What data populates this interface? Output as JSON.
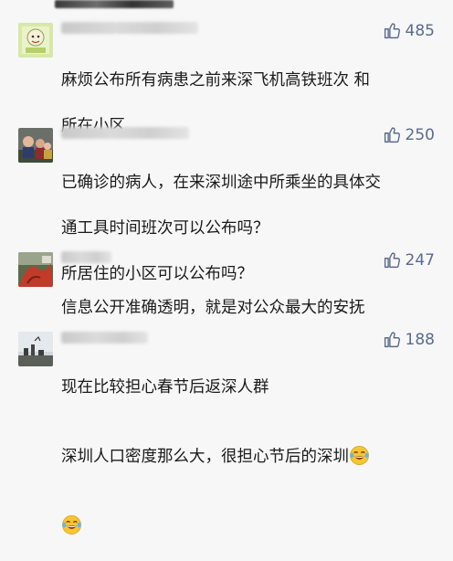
{
  "comments": [
    {
      "likes": "485",
      "lines": [
        "麻烦公布所有病患之前来深飞机高铁班次 和",
        "所在小区"
      ]
    },
    {
      "likes": "250",
      "lines": [
        "已确诊的病人，在来深圳途中所乘坐的具体交",
        "通工具时间班次可以公布吗？",
        "所居住的小区可以公布吗？"
      ]
    },
    {
      "likes": "247",
      "lines": [
        "信息公开准确透明，就是对公众最大的安抚"
      ]
    },
    {
      "likes": "188",
      "lines": [
        "现在比较担心春节后返深人群",
        "深圳人口密度那么大，很担心节后的深圳"
      ]
    }
  ],
  "icons": {
    "like": "thumbs-up-icon",
    "emoji": "crying-laughing-emoji"
  },
  "colors": {
    "background": "#f7f7f7",
    "text": "#1a1a1a",
    "like": "#5a6b8c"
  }
}
